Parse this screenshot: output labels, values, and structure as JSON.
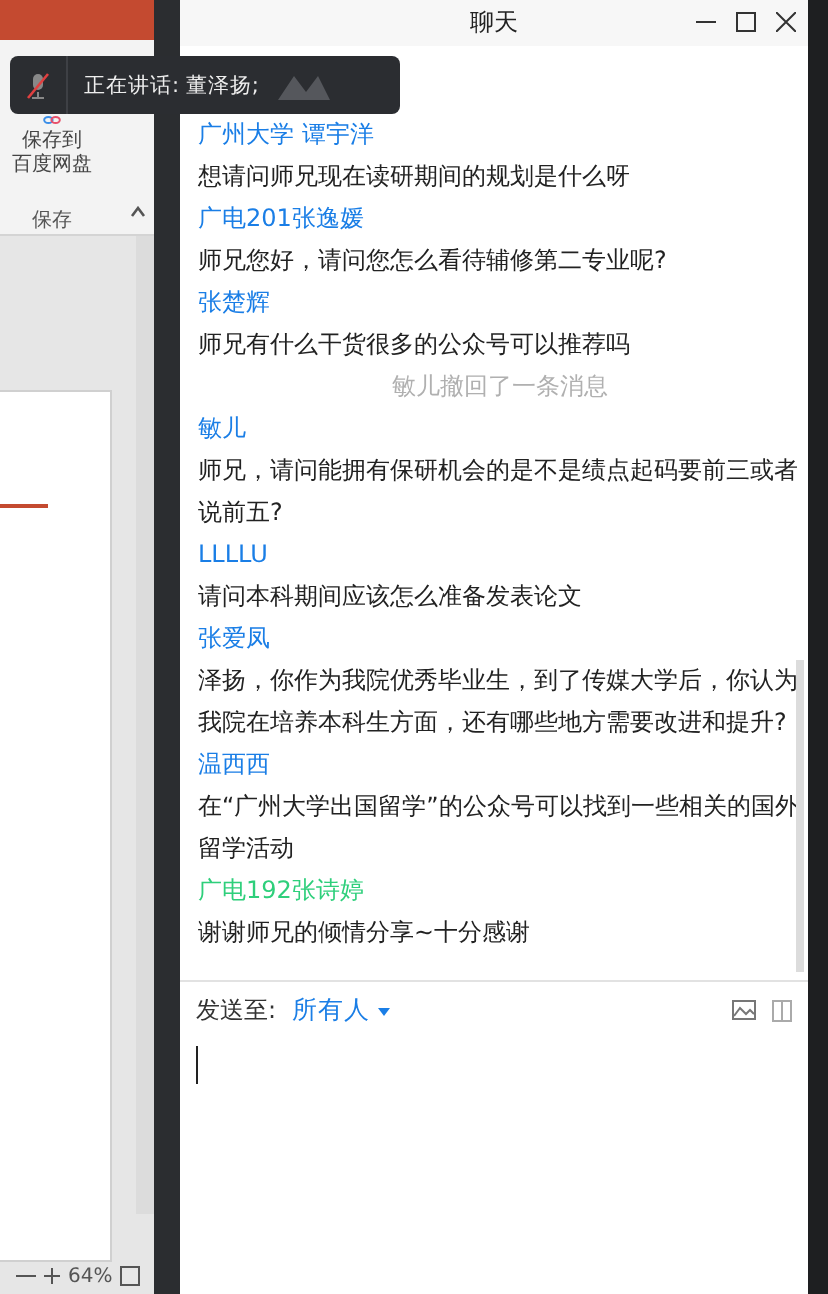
{
  "ribbon": {
    "button_lines": [
      "保存到",
      "百度网盘"
    ],
    "group": "保存"
  },
  "toast": {
    "muted": true,
    "text": "正在讲话: 董泽扬;"
  },
  "chat": {
    "title": "聊天",
    "messages": [
      {
        "kind": "message",
        "sender": "广州大学 谭宇洋",
        "color": "#1a7ee6",
        "text": "想请问师兄现在读研期间的规划是什么呀"
      },
      {
        "kind": "message",
        "sender": "广电201张逸媛",
        "color": "#1a7ee6",
        "text": "师兄您好，请问您怎么看待辅修第二专业呢?"
      },
      {
        "kind": "message",
        "sender": "张楚辉",
        "color": "#1a7ee6",
        "text": "师兄有什么干货很多的公众号可以推荐吗"
      },
      {
        "kind": "recall",
        "text": "敏儿撤回了一条消息"
      },
      {
        "kind": "message",
        "sender": "敏儿",
        "color": "#1a7ee6",
        "text": "师兄，请问能拥有保研机会的是不是绩点起码要前三或者说前五?"
      },
      {
        "kind": "message",
        "sender": "LLLLU",
        "color": "#1a7ee6",
        "text": "请问本科期间应该怎么准备发表论文"
      },
      {
        "kind": "message",
        "sender": "张爱凤",
        "color": "#1a7ee6",
        "text": "泽扬，你作为我院优秀毕业生，到了传媒大学后，你认为我院在培养本科生方面，还有哪些地方需要改进和提升?"
      },
      {
        "kind": "message",
        "sender": "温西西",
        "color": "#1a7ee6",
        "text": "在“广州大学出国留学”的公众号可以找到一些相关的国外留学活动"
      },
      {
        "kind": "message",
        "sender": "广电192张诗婷",
        "color": "#2ecf7b",
        "text": "谢谢师兄的倾情分享~十分感谢"
      }
    ],
    "composer": {
      "label": "发送至:",
      "recipient": "所有人"
    }
  },
  "status_bar": {
    "zoom": "64%"
  }
}
